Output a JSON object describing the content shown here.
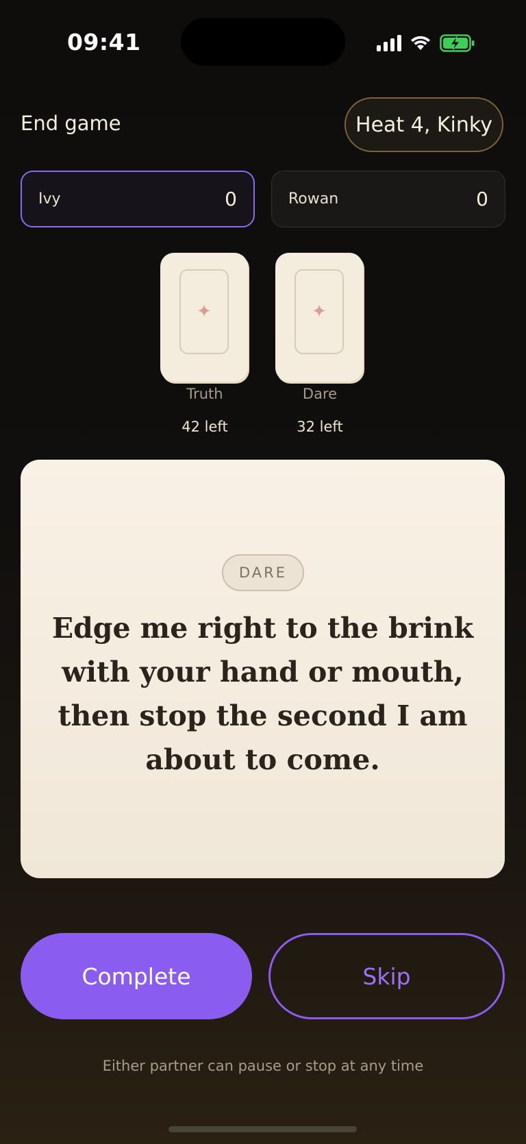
{
  "status_bar": {
    "time": "09:41",
    "icons": [
      "signal-icon",
      "wifi-icon",
      "battery-charging-icon"
    ],
    "battery_color": "#3ecf5a"
  },
  "header": {
    "end_game_label": "End game",
    "heat_label": "Heat 4, Kinky"
  },
  "players": [
    {
      "name": "Ivy",
      "score": "0",
      "active": true
    },
    {
      "name": "Rowan",
      "score": "0",
      "active": false
    }
  ],
  "decks": [
    {
      "label": "Truth",
      "count": "42 left",
      "icon": "sparkle-icon"
    },
    {
      "label": "Dare",
      "count": "32 left",
      "icon": "sparkle-icon"
    }
  ],
  "prompt": {
    "category": "DARE",
    "text": "Edge me right to the brink with your hand or mouth, then stop the second I am about to come."
  },
  "actions": {
    "complete_label": "Complete",
    "skip_label": "Skip"
  },
  "footer": {
    "note": "Either partner can pause or stop at any time"
  },
  "colors": {
    "accent": "#8a5cf0",
    "heat_border": "#7d6634",
    "card_cream": "#f4ecdc",
    "sparkle": "#dd9a96"
  }
}
